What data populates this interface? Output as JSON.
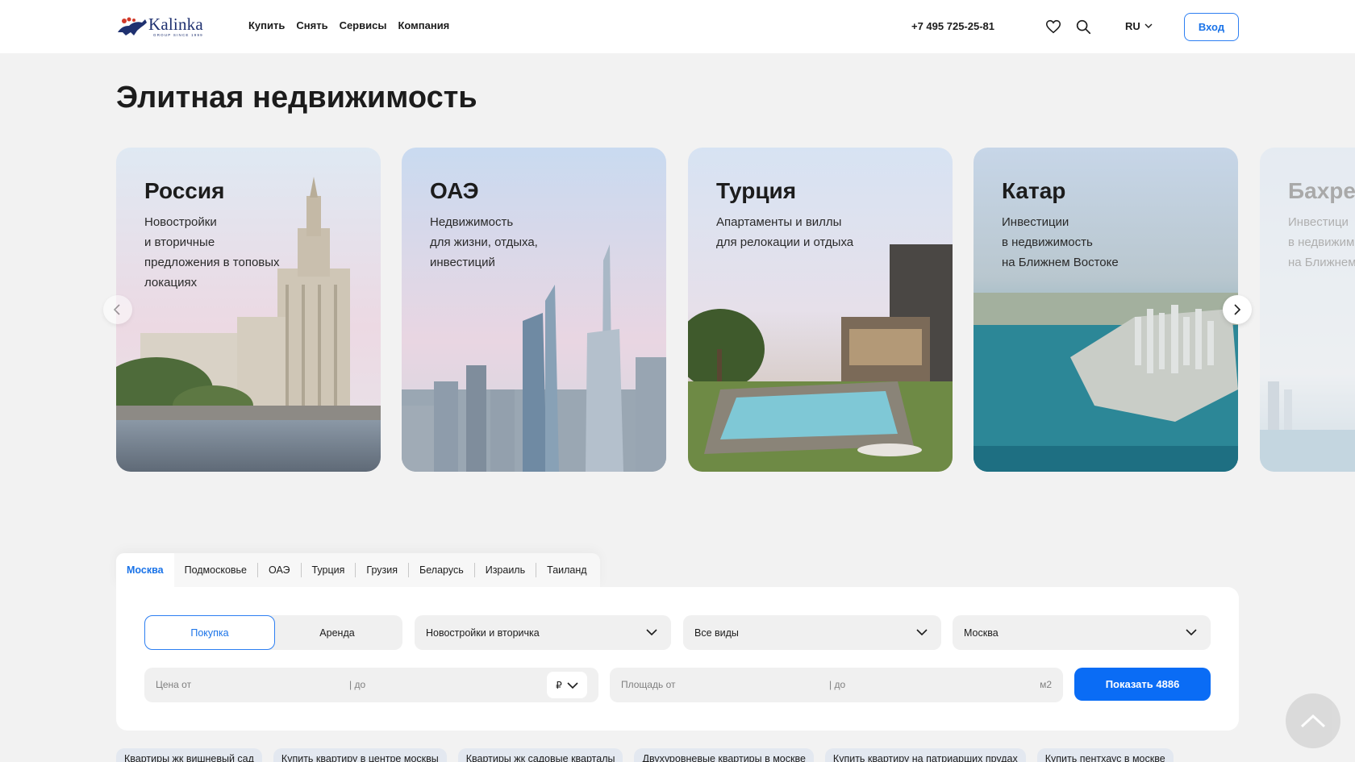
{
  "header": {
    "logo_text": "Kalinka",
    "logo_sub": "GROUP SINCE 1999",
    "nav": [
      "Купить",
      "Снять",
      "Сервисы",
      "Компания"
    ],
    "phone": "+7 495 725-25-81",
    "lang": "RU",
    "login": "Вход"
  },
  "page_title": "Элитная недвижимость",
  "cards": [
    {
      "title": "Россия",
      "text": "Новостройки\nи вторичные\nпредложения в топовых\nлокациях"
    },
    {
      "title": "ОАЭ",
      "text": "Недвижимость\nдля жизни, отдыха,\nинвестиций"
    },
    {
      "title": "Турция",
      "text": "Апартаменты и виллы\nдля релокации и отдыха"
    },
    {
      "title": "Катар",
      "text": "Инвестиции\nв недвижимость\nна Ближнем Востоке"
    },
    {
      "title": "Бахре",
      "text": "Инвестици\nв недвижим\nна Ближнем"
    }
  ],
  "search": {
    "tabs": [
      "Москва",
      "Подмосковье",
      "ОАЭ",
      "Турция",
      "Грузия",
      "Беларусь",
      "Израиль",
      "Таиланд"
    ],
    "deal_buy": "Покупка",
    "deal_rent": "Аренда",
    "select_type": "Новостройки и вторичка",
    "select_kind": "Все виды",
    "select_city": "Москва",
    "price_from": "Цена от",
    "price_to": "| до",
    "currency": "₽",
    "area_from": "Площадь от",
    "area_to": "| до",
    "area_unit": "м2",
    "show_button": "Показать 4886"
  },
  "chips": [
    "Квартиры жк вишневый сад",
    "Купить квартиру в центре москвы",
    "Квартиры жк садовые кварталы",
    "Двухуровневые квартиры в москве",
    "Купить квартиру на патриарших прудах",
    "Купить пентхаус в москве"
  ]
}
